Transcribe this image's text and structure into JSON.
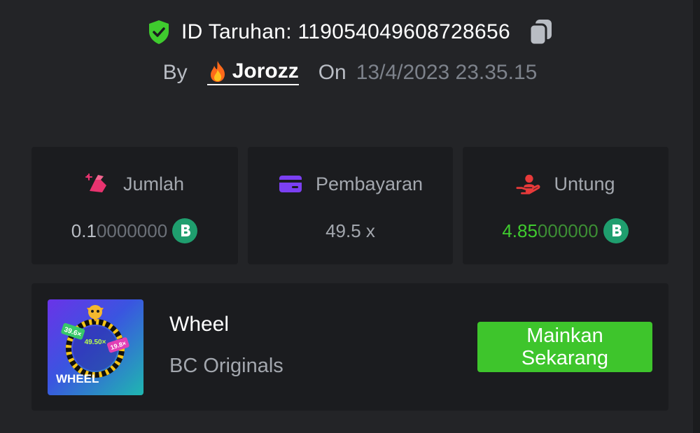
{
  "bet": {
    "id_label": "ID Taruhan: 119054049608728656",
    "verified_icon": "shield-check-icon",
    "copy_icon": "copy-icon",
    "by_label": "By",
    "username": "Jorozz",
    "on_label": "On",
    "datetime": "13/4/2023 23.35.15"
  },
  "stats": [
    {
      "label": "Jumlah",
      "icon": "bet-amount-icon",
      "value_main": "0.1",
      "value_tail": "0000000",
      "currency_icon": "bc-coin-icon",
      "color": "#e8336f"
    },
    {
      "label": "Pembayaran",
      "icon": "wallet-card-icon",
      "value": "49.5 x",
      "color": "#7b3ff2"
    },
    {
      "label": "Untung",
      "icon": "profit-hand-icon",
      "value_main": "4.85",
      "value_tail": "000000",
      "currency_icon": "bc-coin-icon",
      "color": "#e83a3a"
    }
  ],
  "game": {
    "thumbnail_title": "WHEEL",
    "thumb_center": "49.50×",
    "thumb_left": "39.6×",
    "thumb_right": "19.8×",
    "name": "Wheel",
    "provider": "BC Originals",
    "play_label": "Mainkan Sekarang",
    "play_color": "#3ec52c"
  },
  "colors": {
    "background": "#232427",
    "card": "#1b1c1f",
    "profit_green": "#3fcb2e",
    "coin_green": "#1f9e6e"
  }
}
